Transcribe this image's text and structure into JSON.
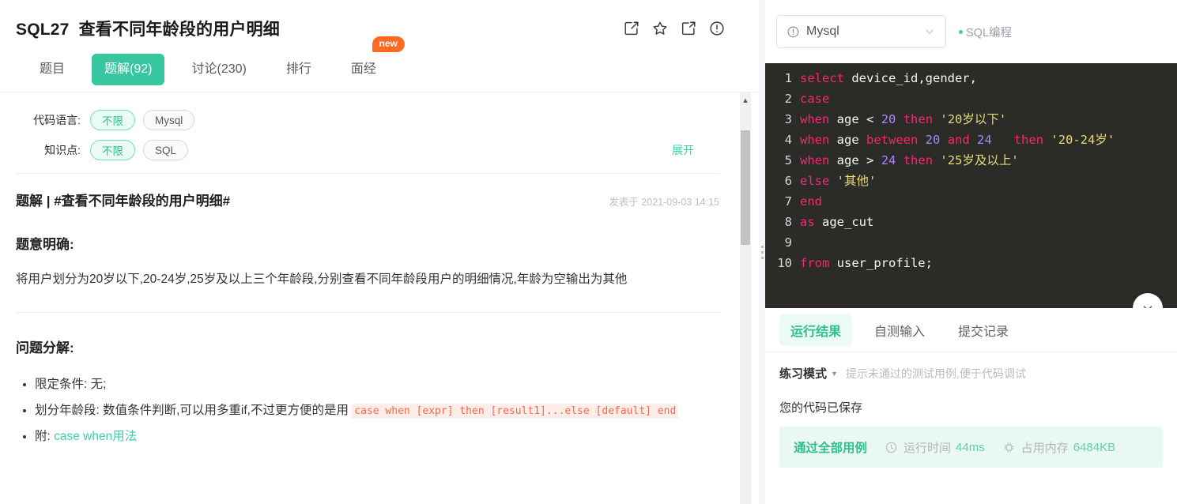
{
  "header": {
    "problem_code": "SQL27",
    "problem_title": "查看不同年龄段的用户明细",
    "icons": [
      "edit-icon",
      "star-icon",
      "share-icon",
      "report-icon"
    ]
  },
  "tabs": [
    {
      "label": "题目",
      "active": false,
      "badge": null
    },
    {
      "label": "题解(92)",
      "active": true,
      "badge": null
    },
    {
      "label": "讨论(230)",
      "active": false,
      "badge": null
    },
    {
      "label": "排行",
      "active": false,
      "badge": null
    },
    {
      "label": "面经",
      "active": false,
      "badge": "new"
    }
  ],
  "filters": [
    {
      "label": "代码语言:",
      "chips": [
        {
          "text": "不限",
          "selected": true
        },
        {
          "text": "Mysql",
          "selected": false
        }
      ]
    },
    {
      "label": "知识点:",
      "chips": [
        {
          "text": "不限",
          "selected": true
        },
        {
          "text": "SQL",
          "selected": false
        }
      ],
      "expand": "展开"
    }
  ],
  "post": {
    "title": "题解 | #查看不同年龄段的用户明细#",
    "date": "发表于 2021-09-03 14:15",
    "section1_heading": "题意明确:",
    "section1_body": "将用户划分为20岁以下,20-24岁,25岁及以上三个年龄段,分别查看不同年龄段用户的明细情况,年龄为空输出为其他",
    "section2_heading": "问题分解:",
    "bullets": [
      {
        "text": "限定条件: 无;"
      },
      {
        "prefix": "划分年龄段: 数值条件判断,可以用多重if,不过更方便的是用 ",
        "code": "case when [expr] then [result1]...else [default] end"
      },
      {
        "prefix": "附: ",
        "link": "case when用法"
      }
    ]
  },
  "editor_panel": {
    "language_selector": {
      "value": "Mysql",
      "icon": "info-circle-icon",
      "chevron": "chevron-down-icon"
    },
    "sql_tag": "SQL编程",
    "collapse_icon": "chevron-down-icon",
    "code_lines": [
      {
        "n": "1",
        "tokens": [
          {
            "t": "select",
            "c": "kw"
          },
          {
            "t": " device_id,gender,",
            "c": "plain"
          }
        ]
      },
      {
        "n": "2",
        "tokens": [
          {
            "t": "case",
            "c": "kw"
          }
        ]
      },
      {
        "n": "3",
        "tokens": [
          {
            "t": "when",
            "c": "kw"
          },
          {
            "t": " age ",
            "c": "plain"
          },
          {
            "t": "<",
            "c": "plain"
          },
          {
            "t": " ",
            "c": "plain"
          },
          {
            "t": "20",
            "c": "num"
          },
          {
            "t": " ",
            "c": "plain"
          },
          {
            "t": "then",
            "c": "kw"
          },
          {
            "t": " ",
            "c": "plain"
          },
          {
            "t": "'20岁以下'",
            "c": "str"
          }
        ]
      },
      {
        "n": "4",
        "tokens": [
          {
            "t": "when",
            "c": "kw"
          },
          {
            "t": " age ",
            "c": "plain"
          },
          {
            "t": "between",
            "c": "kw"
          },
          {
            "t": " ",
            "c": "plain"
          },
          {
            "t": "20",
            "c": "num"
          },
          {
            "t": " ",
            "c": "plain"
          },
          {
            "t": "and",
            "c": "kw"
          },
          {
            "t": " ",
            "c": "plain"
          },
          {
            "t": "24",
            "c": "num"
          },
          {
            "t": "   ",
            "c": "plain"
          },
          {
            "t": "then",
            "c": "kw"
          },
          {
            "t": " ",
            "c": "plain"
          },
          {
            "t": "'20-24岁'",
            "c": "str"
          }
        ]
      },
      {
        "n": "5",
        "tokens": [
          {
            "t": "when",
            "c": "kw"
          },
          {
            "t": " age ",
            "c": "plain"
          },
          {
            "t": ">",
            "c": "plain"
          },
          {
            "t": " ",
            "c": "plain"
          },
          {
            "t": "24",
            "c": "num"
          },
          {
            "t": " ",
            "c": "plain"
          },
          {
            "t": "then",
            "c": "kw"
          },
          {
            "t": " ",
            "c": "plain"
          },
          {
            "t": "'25岁及以上'",
            "c": "str"
          }
        ]
      },
      {
        "n": "6",
        "tokens": [
          {
            "t": "else",
            "c": "kw"
          },
          {
            "t": " ",
            "c": "plain"
          },
          {
            "t": "'其他'",
            "c": "str"
          }
        ]
      },
      {
        "n": "7",
        "tokens": [
          {
            "t": "end",
            "c": "kw"
          }
        ]
      },
      {
        "n": "8",
        "tokens": [
          {
            "t": "as",
            "c": "kw"
          },
          {
            "t": " age_cut",
            "c": "plain"
          }
        ]
      },
      {
        "n": "9",
        "tokens": []
      },
      {
        "n": "10",
        "tokens": [
          {
            "t": "from",
            "c": "kw"
          },
          {
            "t": " user_profile;",
            "c": "plain"
          }
        ]
      }
    ]
  },
  "results_panel": {
    "tabs": [
      {
        "label": "运行结果",
        "active": true
      },
      {
        "label": "自测输入",
        "active": false
      },
      {
        "label": "提交记录",
        "active": false
      }
    ],
    "mode_name": "练习模式",
    "mode_hint": "提示未通过的测试用例,便于代码调试",
    "saved_text": "您的代码已保存",
    "result": {
      "status": "通过全部用例",
      "time_label": "运行时间",
      "time_value": "44ms",
      "memory_label": "占用内存",
      "memory_value": "6484KB",
      "time_icon": "clock-icon",
      "memory_icon": "chip-icon"
    }
  },
  "colors": {
    "accent_green": "#37c6a0",
    "badge_orange": "#ff6a22",
    "editor_bg": "#2b2b28",
    "keyword": "#f92672",
    "number": "#ae81ff",
    "string": "#e6db74"
  }
}
